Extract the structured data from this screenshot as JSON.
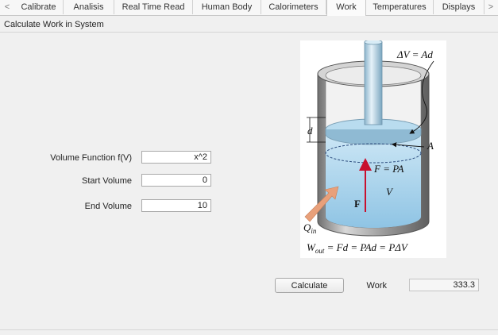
{
  "tabs": {
    "prev_arrow": "<",
    "next_arrow": ">",
    "items": [
      {
        "label": "Calibrate"
      },
      {
        "label": "Analisis"
      },
      {
        "label": "Real Time Read"
      },
      {
        "label": "Human Body"
      },
      {
        "label": "Calorimeters"
      },
      {
        "label": "Work"
      },
      {
        "label": "Temperatures"
      },
      {
        "label": "Displays"
      }
    ],
    "active": "Work"
  },
  "panel": {
    "title": "Calculate Work in System"
  },
  "form": {
    "function_label": "Volume Function f(V)",
    "function_value": "x^2",
    "start_label": "Start Volume",
    "start_value": "0",
    "end_label": "End Volume",
    "end_value": "10"
  },
  "figure": {
    "delta_v_eq": "ΔV = Ad",
    "d_label": "d",
    "a_label": "A",
    "f_eq": "F = PA",
    "v_label": "V",
    "f_label": "F",
    "q_label": "Q",
    "q_sub": "in",
    "w_label": "W",
    "w_sub": "out",
    "w_eq": " = Fd = PAd = PΔV",
    "colors": {
      "liquid": "#a9d4ec",
      "cylinder": "#8c8c8c",
      "piston": "#cfe6f3",
      "arrow_force": "#c8102e",
      "arrow_heat": "#e8a07a"
    }
  },
  "actions": {
    "calculate_label": "Calculate",
    "work_label": "Work",
    "work_value": "333.3"
  }
}
